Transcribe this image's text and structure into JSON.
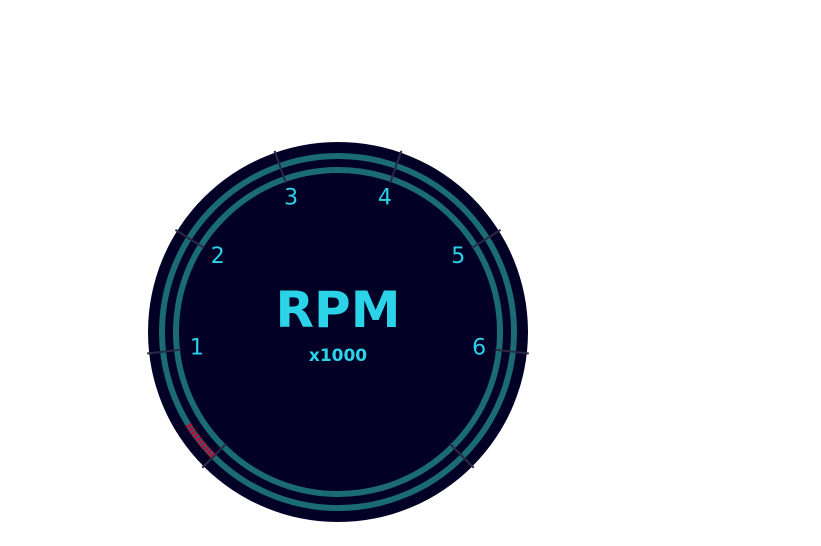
{
  "gauge": {
    "title": "RPM",
    "multiplier": "x1000",
    "scale_labels": [
      "1",
      "2",
      "3",
      "4",
      "5",
      "6"
    ],
    "min_value": 0,
    "max_value": 7,
    "start_angle_deg": 225,
    "end_angle_deg": -45,
    "current_value": 0.35,
    "redline_segments": 10
  },
  "colors": {
    "face": "#030026",
    "ring": "#1a6b73",
    "text": "#2bd3e8",
    "tick": "#2a2a44",
    "redline": "#b0123d",
    "page_background": "#ffffff"
  }
}
